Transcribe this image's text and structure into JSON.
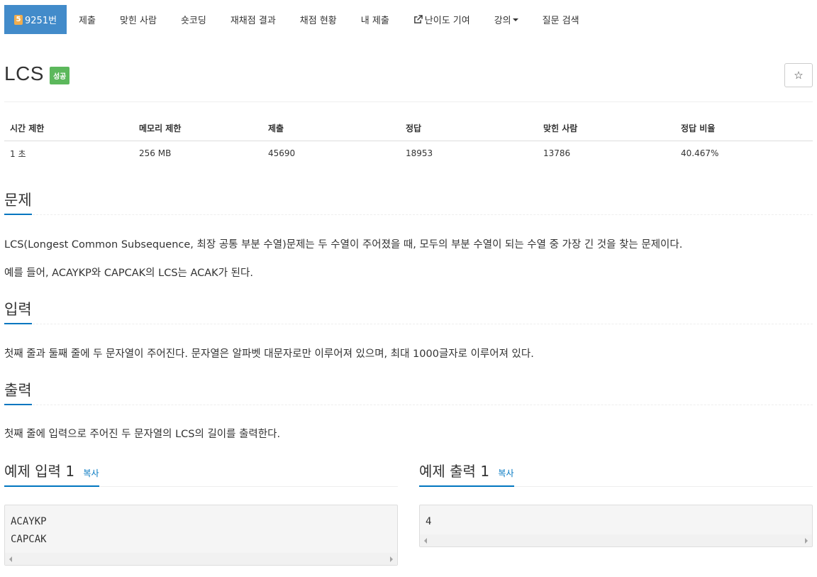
{
  "nav": {
    "problem_number": "9251번",
    "tier_badge": "5",
    "items": [
      "제출",
      "맞힌 사람",
      "숏코딩",
      "재채점 결과",
      "채점 현황",
      "내 제출",
      "난이도 기여",
      "강의",
      "질문 검색"
    ]
  },
  "problem": {
    "title": "LCS",
    "status_label": "성공",
    "favorite_icon": "☆"
  },
  "info_table": {
    "headers": [
      "시간 제한",
      "메모리 제한",
      "제출",
      "정답",
      "맞힌 사람",
      "정답 비율"
    ],
    "values": [
      "1 초",
      "256 MB",
      "45690",
      "18953",
      "13786",
      "40.467%"
    ]
  },
  "sections": {
    "description": {
      "heading": "문제",
      "paragraphs": [
        "LCS(Longest Common Subsequence, 최장 공통 부분 수열)문제는 두 수열이 주어졌을 때, 모두의 부분 수열이 되는 수열 중 가장 긴 것을 찾는 문제이다.",
        "예를 들어, ACAYKP와 CAPCAK의 LCS는 ACAK가 된다."
      ]
    },
    "input": {
      "heading": "입력",
      "text": "첫째 줄과 둘째 줄에 두 문자열이 주어진다. 문자열은 알파벳 대문자로만 이루어져 있으며, 최대 1000글자로 이루어져 있다."
    },
    "output": {
      "heading": "출력",
      "text": "첫째 줄에 입력으로 주어진 두 문자열의 LCS의 길이를 출력한다."
    }
  },
  "samples": {
    "input": {
      "heading": "예제 입력 1",
      "copy_label": "복사",
      "content": "ACAYKP\nCAPCAK"
    },
    "output": {
      "heading": "예제 출력 1",
      "copy_label": "복사",
      "content": "4"
    }
  },
  "colors": {
    "primary": "#428bca",
    "success": "#5cb85c",
    "tier": "#f0ad4e",
    "accent_line": "#0076c0"
  }
}
